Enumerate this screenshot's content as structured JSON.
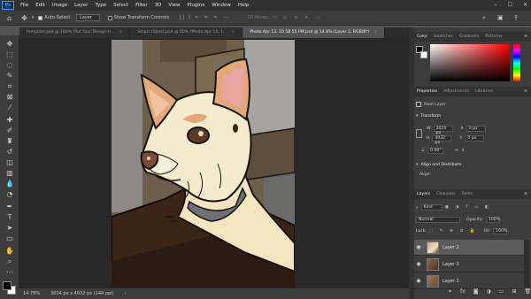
{
  "menubar": {
    "app_logo": "Ps",
    "items": [
      "File",
      "Edit",
      "Image",
      "Layer",
      "Type",
      "Select",
      "Filter",
      "3D",
      "View",
      "Plugins",
      "Window",
      "Help"
    ],
    "window_controls": [
      "–",
      "☐",
      "✕"
    ]
  },
  "options_bar": {
    "auto_select_label": "Auto-Select:",
    "auto_select_value": "Layer",
    "transform_label": "Show Transform Controls",
    "mode_3d": "3D Mode:"
  },
  "tabs": [
    {
      "label": "template.psd @ 100% (Put Your Design H...",
      "active": false
    },
    {
      "label": "Smart Object.psd @ 50% (Photo Apr 14, 1...",
      "active": false
    },
    {
      "label": "Photo Apr 13, 10 58 55 PM.psd @ 14.8% (Layer 2, RGB/8*)",
      "active": true
    }
  ],
  "status": {
    "zoom": "14.78%",
    "dims": "3024 px x 4032 px (144 ppi)"
  },
  "color_panel": {
    "tabs": [
      "Color",
      "Swatches",
      "Gradients",
      "Patterns"
    ]
  },
  "properties_panel": {
    "tabs": [
      "Properties",
      "Adjustments",
      "Libraries"
    ],
    "kind": "Pixel Layer",
    "section_transform": "Transform",
    "w_label": "W",
    "w_value": "3024 px",
    "h_label": "H",
    "h_value": "4032 px",
    "x_label": "X",
    "x_value": "0 px",
    "y_label": "Y",
    "y_value": "0 px",
    "angle_value": "0.00°",
    "section_align": "Align and Distribute",
    "align_label": "Align:"
  },
  "layers_panel": {
    "tabs": [
      "Layers",
      "Channels",
      "Paths"
    ],
    "filter": "Kind",
    "blend_mode": "Normal",
    "opacity_label": "Opacity:",
    "opacity_value": "100%",
    "lock_label": "Lock:",
    "fill_label": "Fill:",
    "fill_value": "100%",
    "layers": [
      {
        "name": "Layer 2",
        "selected": true
      },
      {
        "name": "Layer 3",
        "selected": false
      },
      {
        "name": "Layer 1",
        "selected": false
      }
    ]
  },
  "colors": {
    "accent": "#31a8ff",
    "ui_dark": "#323232",
    "ui_mid": "#3c3c3c"
  }
}
